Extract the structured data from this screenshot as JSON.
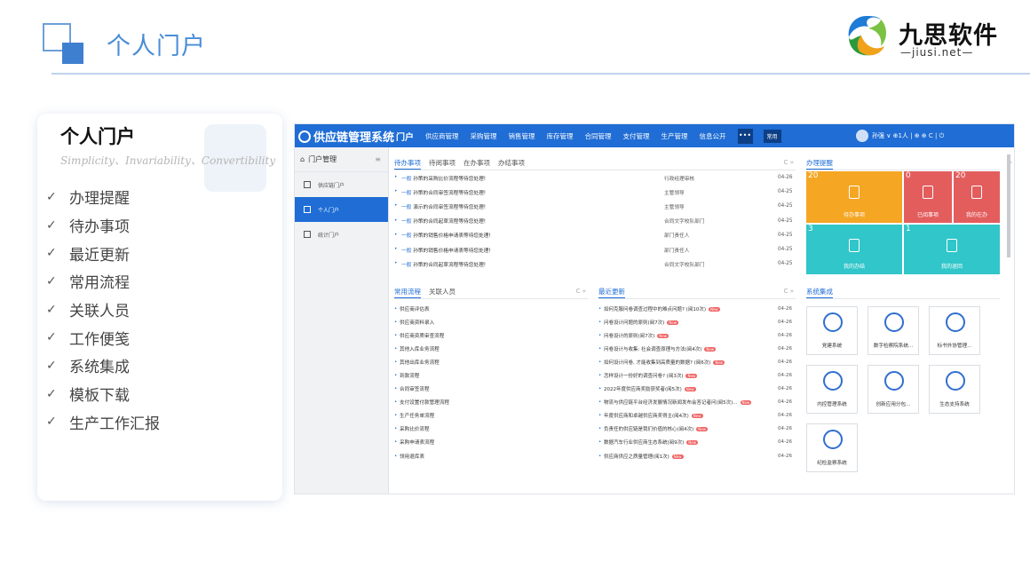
{
  "slide": {
    "title": "个人门户",
    "logo_text": "九思软件",
    "logo_url": "jiusi.net"
  },
  "card": {
    "title": "个人门户",
    "subtitle": "Simplicity、Invariability、Convertibility",
    "items": [
      "办理提醒",
      "待办事项",
      "最近更新",
      "常用流程",
      "关联人员",
      "工作便笺",
      "系统集成",
      "模板下载",
      "生产工作汇报"
    ]
  },
  "app": {
    "brand": "供应链管理系统",
    "nav": [
      "门户",
      "供应商管理",
      "采购管理",
      "销售管理",
      "库存管理",
      "合同管理",
      "支付管理",
      "生产管理",
      "信息公开"
    ],
    "nav_more": "•••",
    "nav_common": "常用",
    "user": "孙强 ∨  ⊕1人 | ⊕ ⊕ C | ⏻",
    "sidebar": {
      "header": "门户管理",
      "items": [
        "供应链门户",
        "个人门户",
        "统计门户"
      ]
    },
    "todo": {
      "tabs": [
        "待办事项",
        "待阅事项",
        "在办事项",
        "办结事项"
      ],
      "rows": [
        {
          "lvl": "一般",
          "title": "孙策的采购比价流程等待您处理!",
          "node": "行政经理审核",
          "date": "04-26"
        },
        {
          "lvl": "一般",
          "title": "孙策的合同审签流程等待您处理!",
          "node": "主管领导",
          "date": "04-25"
        },
        {
          "lvl": "一般",
          "title": "演示的合同审签流程等待您处理!",
          "node": "主管领导",
          "date": "04-25"
        },
        {
          "lvl": "一般",
          "title": "孙策的合同起草流程等待您处理!",
          "node": "合同文字校队部门",
          "date": "04-25"
        },
        {
          "lvl": "一般",
          "title": "孙策的销售价格申请表等待您处理!",
          "node": "部门责任人",
          "date": "04-25"
        },
        {
          "lvl": "一般",
          "title": "孙策的销售价格申请表等待您处理!",
          "node": "部门责任人",
          "date": "04-25"
        },
        {
          "lvl": "一般",
          "title": "孙策的合同起草流程等待您处理!",
          "node": "合同文字校队部门",
          "date": "04-25"
        }
      ]
    },
    "reminders": {
      "title": "办理提醒",
      "tiles": [
        {
          "count": "20",
          "label": "待办事项",
          "color": "#f5a623"
        },
        {
          "count": "0",
          "label": "已阅事项",
          "color": "#e35d5d"
        },
        {
          "count": "20",
          "label": "我的在办",
          "color": "#e35d5d"
        },
        {
          "count": "3",
          "label": "我的办结",
          "color": "#31c6c9"
        },
        {
          "count": "1",
          "label": "我的退回",
          "color": "#31c6c9"
        }
      ]
    },
    "common": {
      "tabs": [
        "常用流程",
        "关联人员"
      ],
      "items": [
        "供应商评估表",
        "供应商资料录入",
        "供应商资质审查流程",
        "其他入库业务流程",
        "其他出库业务流程",
        "到款流程",
        "合同审签流程",
        "支付设置付款管理流程",
        "生产任务单流程",
        "采购比价流程",
        "采购申请表流程",
        "领用退库表"
      ]
    },
    "recent": {
      "title": "最近更新",
      "items": [
        {
          "t": "如何克服问卷调查过程中的难点问题? (阅10次)",
          "d": "04-26"
        },
        {
          "t": "问卷设计问题的原则(阅7次)",
          "d": "04-26"
        },
        {
          "t": "问卷设计的原则(阅7次)",
          "d": "04-26"
        },
        {
          "t": "问卷设计与收集: 社会调查原理与方法(阅4次)",
          "d": "04-26"
        },
        {
          "t": "如何设计问卷, 才能收集到高质量的数据? (阅6次)",
          "d": "04-26"
        },
        {
          "t": "怎样设计一份好的调查问卷? (阅3次)",
          "d": "04-26"
        },
        {
          "t": "2022年度供应商奖励获奖者(阅5次)",
          "d": "04-26"
        },
        {
          "t": "物流与供应链平台经济发展情况新闻发布会答记者问(阅5次)...",
          "d": "04-26"
        },
        {
          "t": "年度供应商和卓越供应商奖得主(阅4次)",
          "d": "04-26"
        },
        {
          "t": "负责任的供应链是我们价值的核心(阅4次)",
          "d": "04-26"
        },
        {
          "t": "数据汽车行业供应商生态系统(阅9次)",
          "d": "04-26"
        },
        {
          "t": "供应商供应之质量管理(阅1次)",
          "d": "04-26"
        }
      ],
      "new_label": "New"
    },
    "systems": {
      "title": "系统集成",
      "apps": [
        {
          "label": "党建系统",
          "color": "#2f6fd0"
        },
        {
          "label": "数字检察院系统...",
          "color": "#2f6fd0"
        },
        {
          "label": "标书外协管理...",
          "color": "#2f6fd0"
        },
        {
          "label": "内控管理系统",
          "color": "#2f6fd0"
        },
        {
          "label": "创新应用分包...",
          "color": "#2f6fd0"
        },
        {
          "label": "生态支持系统",
          "color": "#2f6fd0"
        },
        {
          "label": "纪检监察系统",
          "color": "#2f6fd0"
        }
      ]
    }
  }
}
